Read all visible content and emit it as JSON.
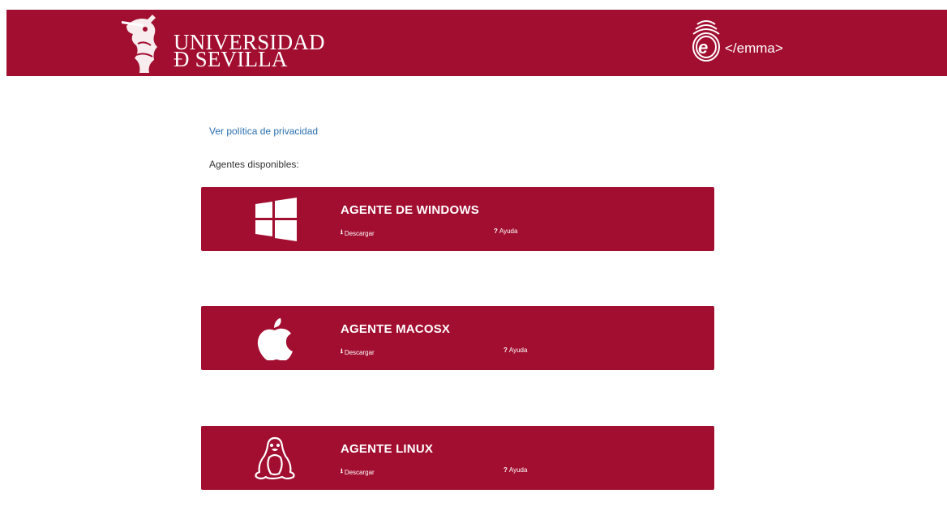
{
  "header": {
    "university_line1": "UNIVERSIDAD",
    "university_line2": "Đ SEVILLA",
    "emma_text": "</emma>"
  },
  "colors": {
    "brand": "#a20e30",
    "link": "#2a6fb0"
  },
  "privacy_link": "Ver política de privacidad",
  "agents_label": "Agentes disponibles:",
  "agents": [
    {
      "title": "AGENTE DE WINDOWS",
      "icon": "windows-icon",
      "download": "Descargar",
      "help": "Ayuda"
    },
    {
      "title": "AGENTE MACOSX",
      "icon": "apple-icon",
      "download": "Descargar",
      "help": "Ayuda"
    },
    {
      "title": "AGENTE LINUX",
      "icon": "linux-icon",
      "download": "Descargar",
      "help": "Ayuda"
    }
  ]
}
